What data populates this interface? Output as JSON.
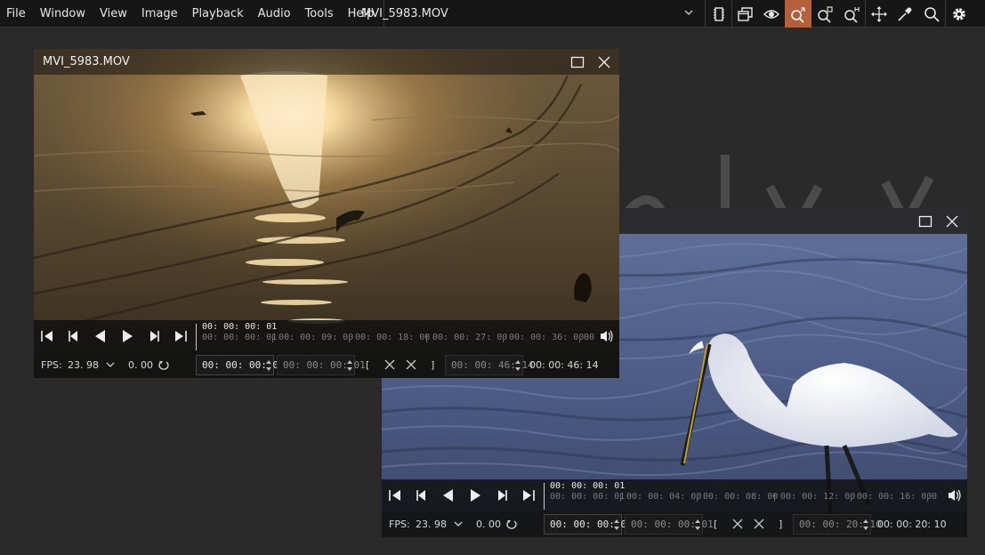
{
  "menubar": {
    "items": [
      "File",
      "Window",
      "View",
      "Image",
      "Playback",
      "Audio",
      "Tools",
      "Help"
    ],
    "current_media": "MVI_5983.MOV"
  },
  "toolbar": {
    "icons": [
      "media-info-icon",
      "window-tile-icon",
      "eye-icon",
      "zoom-fit-icon",
      "zoom-in-icon",
      "zoom-100-icon",
      "move-icon",
      "eyedropper-icon",
      "search-icon",
      "settings-icon"
    ],
    "active": "zoom-fit-icon",
    "accent": "#b5603a"
  },
  "viewer1": {
    "title": "MVI_5983.MOV",
    "timeline": {
      "current": "00: 00: 00: 01",
      "ticks": [
        "00: 00: 00: 01",
        "00: 00: 09: 00",
        "00: 00: 18: 00",
        "00: 00: 27: 00",
        "00: 00: 36: 00",
        "00"
      ]
    },
    "status": {
      "fps_label": "FPS:",
      "fps_value": "23. 98",
      "speed": "0. 00",
      "in_point": "00: 00: 00: 01",
      "current_frame": "00: 00: 00: 01",
      "bracket_open": "[",
      "bracket_close": "]",
      "out_point": "00: 00: 46: 14",
      "duration": "00: 00: 46: 14"
    }
  },
  "viewer2": {
    "title": "",
    "timeline": {
      "current": "00: 00: 00: 01",
      "ticks": [
        "00: 00: 00: 01",
        "00: 00: 04: 00",
        "00: 00: 08: 00",
        "00: 00: 12: 00",
        "00: 00: 16: 00",
        "0"
      ]
    },
    "status": {
      "fps_label": "FPS:",
      "fps_value": "23. 98",
      "speed": "0. 00",
      "in_point": "00: 00: 00: 01",
      "current_frame": "00: 00: 00: 01",
      "bracket_open": "[",
      "bracket_close": "]",
      "out_point": "00: 00: 20: 10",
      "duration": "00: 00: 20: 10"
    }
  }
}
